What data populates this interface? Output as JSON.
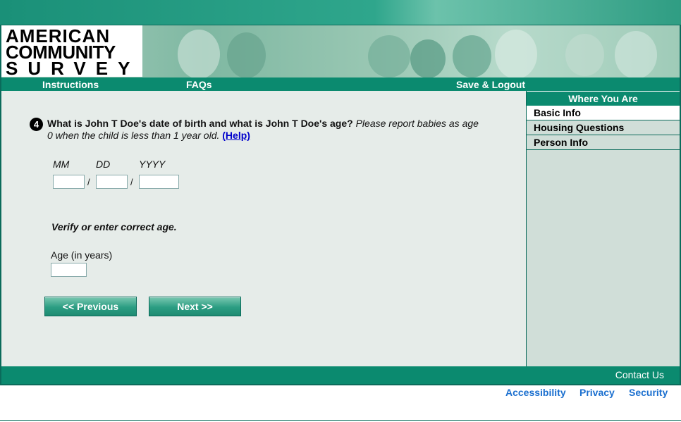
{
  "logo": {
    "line1": "AMERICAN",
    "line2": "COMMUNITY",
    "line3": "SURVEY"
  },
  "nav": {
    "instructions": "Instructions",
    "faqs": "FAQs",
    "save_logout": "Save & Logout"
  },
  "sidebar": {
    "heading": "Where You Are",
    "items": [
      {
        "label": "Basic Info",
        "active": true
      },
      {
        "label": "Housing Questions",
        "active": false
      },
      {
        "label": "Person Info",
        "active": false
      }
    ]
  },
  "question": {
    "number": "4",
    "text_bold": "What is John T Doe's date of birth and what is John T Doe's age?",
    "text_italic": "Please report babies as age 0 when the child is less than 1 year old.",
    "help_label": "(Help)"
  },
  "dob": {
    "mm_label": "MM",
    "dd_label": "DD",
    "yyyy_label": "YYYY",
    "mm_value": "",
    "dd_value": "",
    "yyyy_value": "",
    "separator": "/"
  },
  "verify_text": "Verify or enter correct age.",
  "age": {
    "label": "Age (in years)",
    "value": ""
  },
  "buttons": {
    "previous": "<<   Previous",
    "next": "Next   >>"
  },
  "footer": {
    "contact": "Contact Us",
    "accessibility": "Accessibility",
    "privacy": "Privacy",
    "security": "Security"
  },
  "colors": {
    "brand": "#0b8a6f",
    "panel": "#e6ece9",
    "sidebar": "#d0ded8",
    "link": "#1a6fcf"
  }
}
